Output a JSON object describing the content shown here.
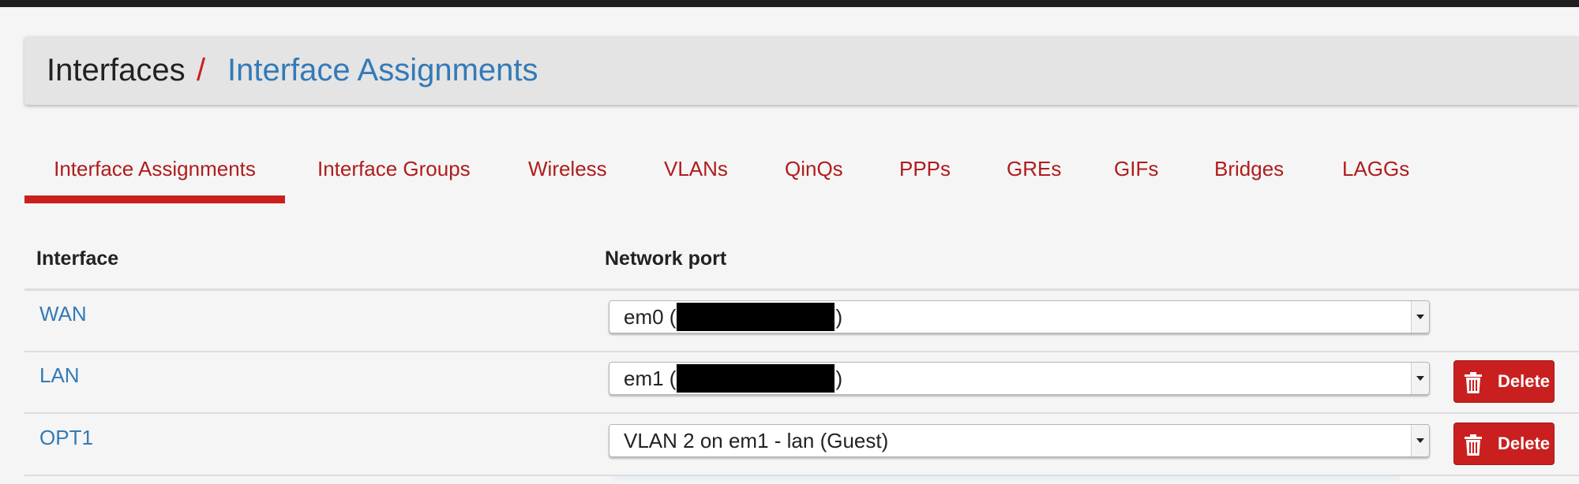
{
  "breadcrumb": {
    "root": "Interfaces",
    "separator": "/",
    "current": "Interface Assignments"
  },
  "tabs": [
    {
      "label": "Interface Assignments",
      "active": true
    },
    {
      "label": "Interface Groups"
    },
    {
      "label": "Wireless"
    },
    {
      "label": "VLANs"
    },
    {
      "label": "QinQs"
    },
    {
      "label": "PPPs"
    },
    {
      "label": "GREs"
    },
    {
      "label": "GIFs"
    },
    {
      "label": "Bridges"
    },
    {
      "label": "LAGGs"
    }
  ],
  "table": {
    "headers": {
      "interface": "Interface",
      "network_port": "Network port"
    },
    "rows": [
      {
        "interface": "WAN",
        "port_prefix": "em0 (",
        "port_suffix": ")",
        "redacted": true,
        "delete": false
      },
      {
        "interface": "LAN",
        "port_prefix": "em1 (",
        "port_suffix": ")",
        "redacted": true,
        "delete": true
      },
      {
        "interface": "OPT1",
        "port_prefix": "VLAN 2 on em1 - lan (Guest)",
        "port_suffix": "",
        "redacted": false,
        "delete": true
      }
    ],
    "delete_label": "Delete"
  },
  "colors": {
    "accent": "#c9201f",
    "link": "#337ab7"
  },
  "icons": {
    "delete": "trash-icon",
    "select": "chevron-down-icon"
  }
}
